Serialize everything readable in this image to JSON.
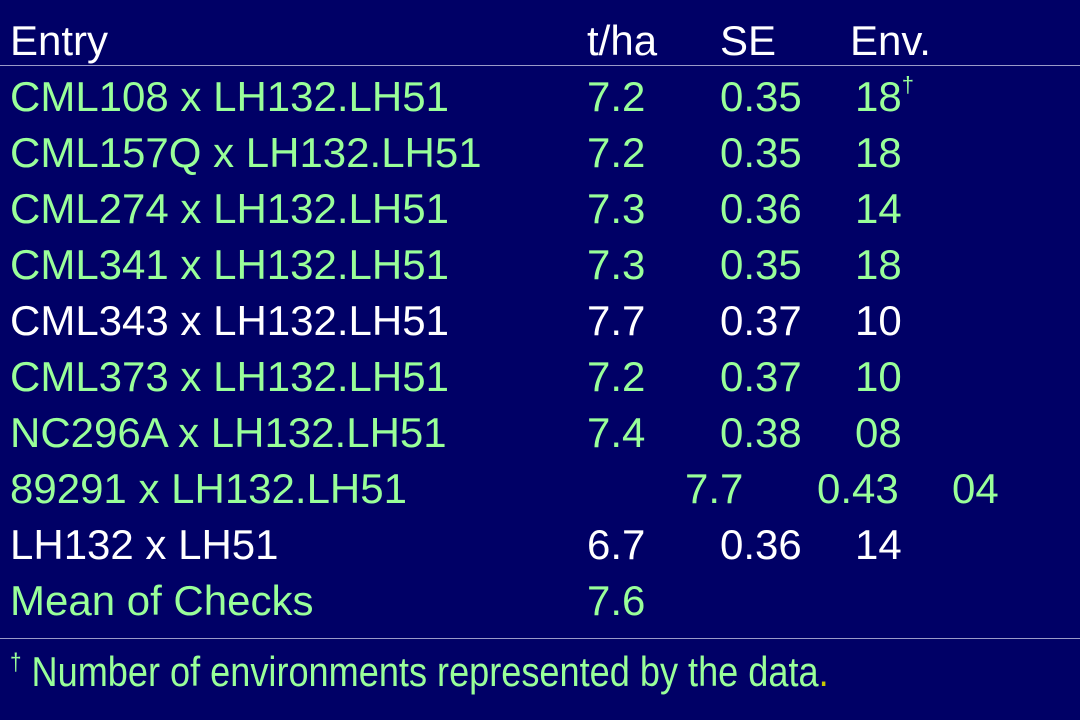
{
  "headers": {
    "entry": "Entry",
    "yield": "t/ha",
    "se": "SE",
    "env": "Env."
  },
  "rows": [
    {
      "entry": "CML108 x LH132.LH51",
      "yield": "7.2",
      "se": "0.35",
      "env": "18",
      "marker": "†",
      "color": "#99ff99"
    },
    {
      "entry": "CML157Q x LH132.LH51",
      "yield": "7.2",
      "se": "0.35",
      "env": "18",
      "color": "#99ff99"
    },
    {
      "entry": "CML274 x LH132.LH51",
      "yield": "7.3",
      "se": "0.36",
      "env": "14",
      "color": "#99ff99"
    },
    {
      "entry": "CML341 x LH132.LH51",
      "yield": "7.3",
      "se": "0.35",
      "env": "18",
      "color": "#99ff99"
    },
    {
      "entry": "CML343 x LH132.LH51",
      "yield": "7.7",
      "se": "0.37",
      "env": "10",
      "color": "#ffffff"
    },
    {
      "entry": "CML373 x LH132.LH51",
      "yield": "7.2",
      "se": "0.37",
      "env": "10",
      "color": "#99ff99"
    },
    {
      "entry": "NC296A x LH132.LH51",
      "yield": "7.4",
      "se": "0.38",
      "env": "08",
      "color": "#99ff99"
    },
    {
      "entry": "89291 x LH132.LH51",
      "yield": "7.7",
      "se": "0.43",
      "env": "04",
      "color": "#99ff99"
    },
    {
      "entry": "LH132 x LH51",
      "yield": "6.7",
      "se": "0.36",
      "env": "14",
      "color": "#ffffff"
    },
    {
      "entry": "Mean of Checks",
      "yield": "7.6",
      "se": "",
      "env": "",
      "color": "#99ff99"
    }
  ],
  "footnote": {
    "marker": "†",
    "text": " Number of environments represented by the data",
    "period": "."
  },
  "colors": {
    "background": "#000066",
    "highlight": "#99ff99",
    "normal": "#ffffff",
    "rule": "#9a9ac8"
  }
}
